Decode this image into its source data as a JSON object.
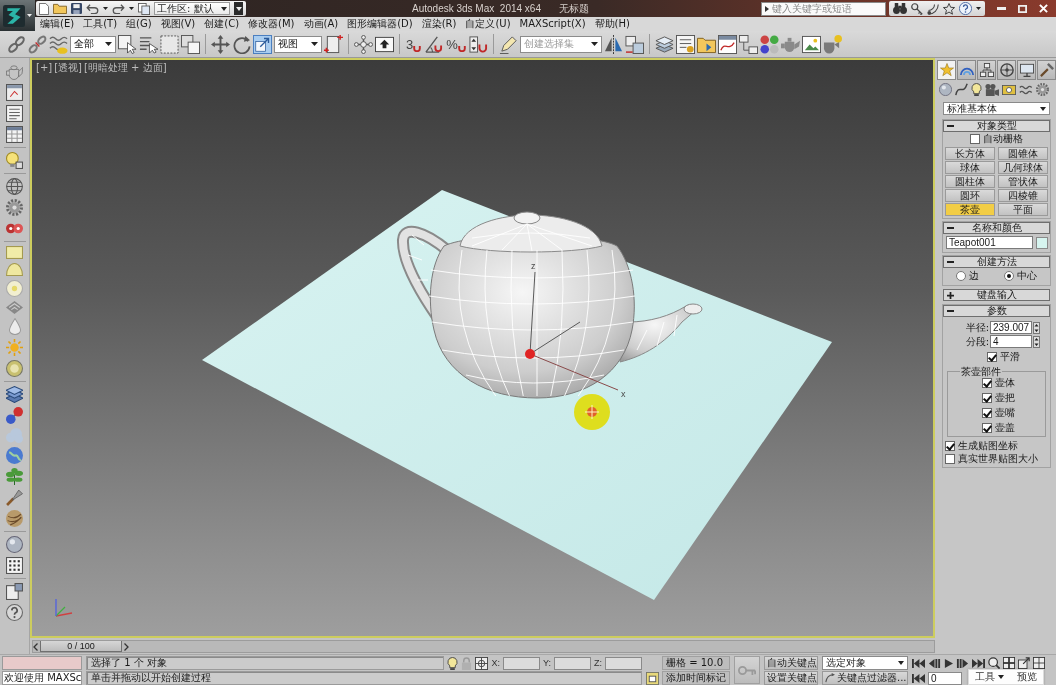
{
  "title_bar": {
    "workspace": "工作区: 默认",
    "title": "Autodesk 3ds Max  2014 x64",
    "document": "无标题",
    "search": {
      "placeholder": "键入关键字或短语"
    }
  },
  "menu_bar": [
    "编辑(E)",
    "工具(T)",
    "组(G)",
    "视图(V)",
    "创建(C)",
    "修改器(M)",
    "动画(A)",
    "图形编辑器(D)",
    "渲染(R)",
    "自定义(U)",
    "MAXScript(X)",
    "帮助(H)"
  ],
  "main_toolbar": [
    {
      "kind": "tool",
      "selected": false
    },
    {
      "kind": "tool",
      "selected": false
    },
    {
      "kind": "tool",
      "selected": false
    },
    {
      "kind": "dropdown",
      "value": "全部"
    },
    {
      "kind": "tool",
      "selected": false
    },
    {
      "kind": "tool",
      "selected": false
    },
    {
      "kind": "tool",
      "selected": false
    },
    {
      "kind": "tool",
      "selected": false
    },
    {
      "kind": "tool",
      "selected": false
    },
    {
      "kind": "tool",
      "selected": false
    },
    {
      "kind": "tool",
      "selected": true
    },
    {
      "kind": "dropdown",
      "value": "视图"
    },
    {
      "kind": "tool",
      "selected": false
    },
    {
      "kind": "tool",
      "selected": false
    },
    {
      "kind": "tool",
      "selected": false
    },
    {
      "kind": "snap",
      "label": "3",
      "selected": false
    },
    {
      "kind": "tool",
      "selected": false
    },
    {
      "kind": "snap",
      "label": "%",
      "selected": false
    },
    {
      "kind": "tool",
      "selected": false
    },
    {
      "kind": "tool",
      "selected": false
    },
    {
      "kind": "dropdown",
      "placeholder": "创建选择集"
    },
    {
      "kind": "tool",
      "selected": false
    },
    {
      "kind": "tool",
      "selected": false
    },
    {
      "kind": "tool",
      "selected": false
    },
    {
      "kind": "tool",
      "selected": false
    },
    {
      "kind": "tool",
      "selected": false
    },
    {
      "kind": "tool",
      "selected": false
    },
    {
      "kind": "tool",
      "selected": false
    },
    {
      "kind": "tool",
      "selected": false
    },
    {
      "kind": "tool",
      "selected": false
    },
    {
      "kind": "tool",
      "selected": false
    },
    {
      "kind": "tool",
      "selected": false
    }
  ],
  "viewport": {
    "active": true,
    "labels": [
      "[+]",
      "[透视]",
      "[明暗处理 + 边面]"
    ],
    "gizmo_axes": [
      "z",
      "x"
    ]
  },
  "command_panel": {
    "tabs": [
      {
        "selected": true
      },
      {
        "selected": false
      },
      {
        "selected": false
      },
      {
        "selected": false
      },
      {
        "selected": false
      },
      {
        "selected": false
      }
    ],
    "category": "标准基本体",
    "rollouts": [
      {
        "kind": "object_type",
        "title": "对象类型",
        "expanded": true,
        "auto_grid": {
          "label": "自动栅格",
          "checked": false
        },
        "buttons": [
          {
            "label": "长方体",
            "selected": false
          },
          {
            "label": "圆锥体",
            "selected": false
          },
          {
            "label": "球体",
            "selected": false
          },
          {
            "label": "几何球体",
            "selected": false
          },
          {
            "label": "圆柱体",
            "selected": false
          },
          {
            "label": "管状体",
            "selected": false
          },
          {
            "label": "圆环",
            "selected": false
          },
          {
            "label": "四棱锥",
            "selected": false
          },
          {
            "label": "茶壶",
            "selected": true
          },
          {
            "label": "平面",
            "selected": false
          }
        ]
      },
      {
        "kind": "name_color",
        "title": "名称和颜色",
        "expanded": true,
        "name": "Teapot001",
        "color": "#d6f4ef"
      },
      {
        "kind": "creation_method",
        "title": "创建方法",
        "expanded": true,
        "options": [
          {
            "label": "边",
            "selected": false
          },
          {
            "label": "中心",
            "selected": true
          }
        ]
      },
      {
        "kind": "keyboard_entry",
        "title": "键盘输入",
        "expanded": false
      },
      {
        "kind": "parameters",
        "title": "参数",
        "expanded": true,
        "fields": [
          {
            "label": "半径:",
            "value": "239.007"
          },
          {
            "label": "分段:",
            "value": "4"
          }
        ],
        "smooth": {
          "label": "平滑",
          "checked": true
        },
        "parts": {
          "title": "茶壶部件",
          "items": [
            {
              "label": "壶体",
              "checked": true
            },
            {
              "label": "壶把",
              "checked": true
            },
            {
              "label": "壶嘴",
              "checked": true
            },
            {
              "label": "壶盖",
              "checked": true
            }
          ]
        },
        "options": [
          {
            "label": "生成贴图坐标",
            "checked": true
          },
          {
            "label": "真实世界贴图大小",
            "checked": false
          }
        ]
      }
    ]
  },
  "timeline": {
    "slider": "0 / 100",
    "level": 0
  },
  "status_bar": {
    "listener": "欢迎使用 MAXSc",
    "prompt": "选择了 1 个 对象",
    "hint": "单击并拖动以开始创建过程",
    "coordinates": [
      "X:",
      "Y:",
      "Z:"
    ],
    "grid": "栅格 = 10.0",
    "time_tag": "添加时间标记",
    "auto_key": "自动关键点",
    "set_key": "设置关键点",
    "key_target": "选定对象",
    "key_filters": "关键点过滤器...",
    "frame": "0"
  },
  "floating_toolbar": {
    "menu": "工具",
    "button": "预览"
  }
}
